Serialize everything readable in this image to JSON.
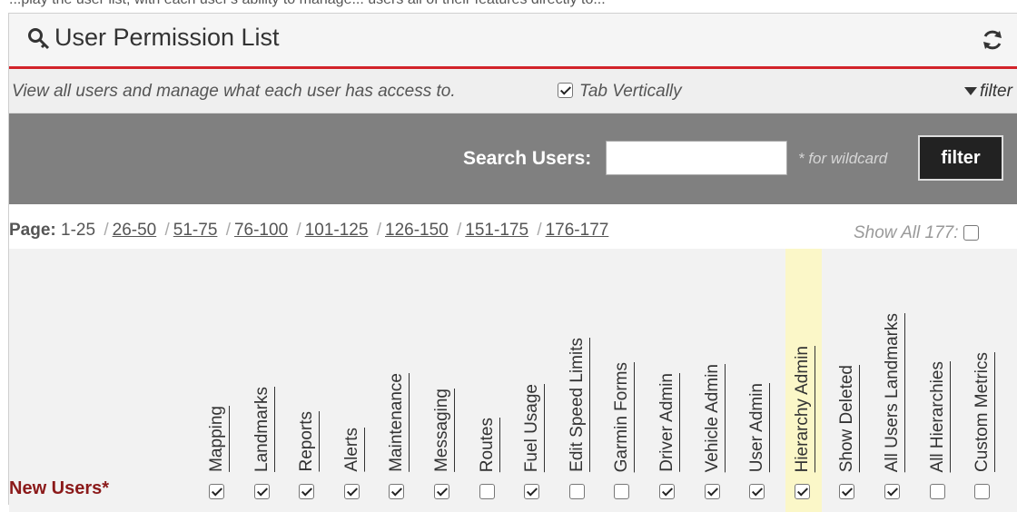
{
  "top_fragment": "...play the user list, with each user's ability to manage... users all of their features directly to...",
  "header": {
    "title": "User Permission List"
  },
  "subbar": {
    "description": "View all users and manage what each user has access to.",
    "tab_vertically_label": "Tab Vertically",
    "tab_vertically_checked": true,
    "filter_link": "filter"
  },
  "search": {
    "label": "Search Users:",
    "value": "",
    "wildcard_hint": "* for wildcard",
    "button": "filter"
  },
  "pagination": {
    "label": "Page:",
    "current": "1-25",
    "pages": [
      "26-50",
      "51-75",
      "76-100",
      "101-125",
      "126-150",
      "151-175",
      "176-177"
    ],
    "show_all_label": "Show All 177:",
    "show_all_checked": false
  },
  "table": {
    "row_label": "New Users*",
    "highlighted_column": "Hierarchy Admin",
    "columns": [
      {
        "label": "Mapping",
        "checked": true
      },
      {
        "label": "Landmarks",
        "checked": true
      },
      {
        "label": "Reports",
        "checked": true
      },
      {
        "label": "Alerts",
        "checked": true
      },
      {
        "label": "Maintenance",
        "checked": true
      },
      {
        "label": "Messaging",
        "checked": true
      },
      {
        "label": "Routes",
        "checked": false
      },
      {
        "label": "Fuel Usage",
        "checked": true
      },
      {
        "label": "Edit Speed Limits",
        "checked": false
      },
      {
        "label": "Garmin Forms",
        "checked": false
      },
      {
        "label": "Driver Admin",
        "checked": true
      },
      {
        "label": "Vehicle Admin",
        "checked": true
      },
      {
        "label": "User Admin",
        "checked": true
      },
      {
        "label": "Hierarchy Admin",
        "checked": true
      },
      {
        "label": "Show Deleted",
        "checked": true
      },
      {
        "label": "All Users Landmarks",
        "checked": true
      },
      {
        "label": "All Hierarchies",
        "checked": false
      },
      {
        "label": "Custom Metrics",
        "checked": false
      }
    ]
  },
  "icons": {
    "title_icon": "key-icon",
    "refresh": "refresh-icon",
    "filter": "funnel-icon"
  },
  "colors": {
    "accent": "#d2232a",
    "search_bar": "#808080",
    "highlight": "#fbf7c8",
    "row_label": "#8b1a1a"
  }
}
